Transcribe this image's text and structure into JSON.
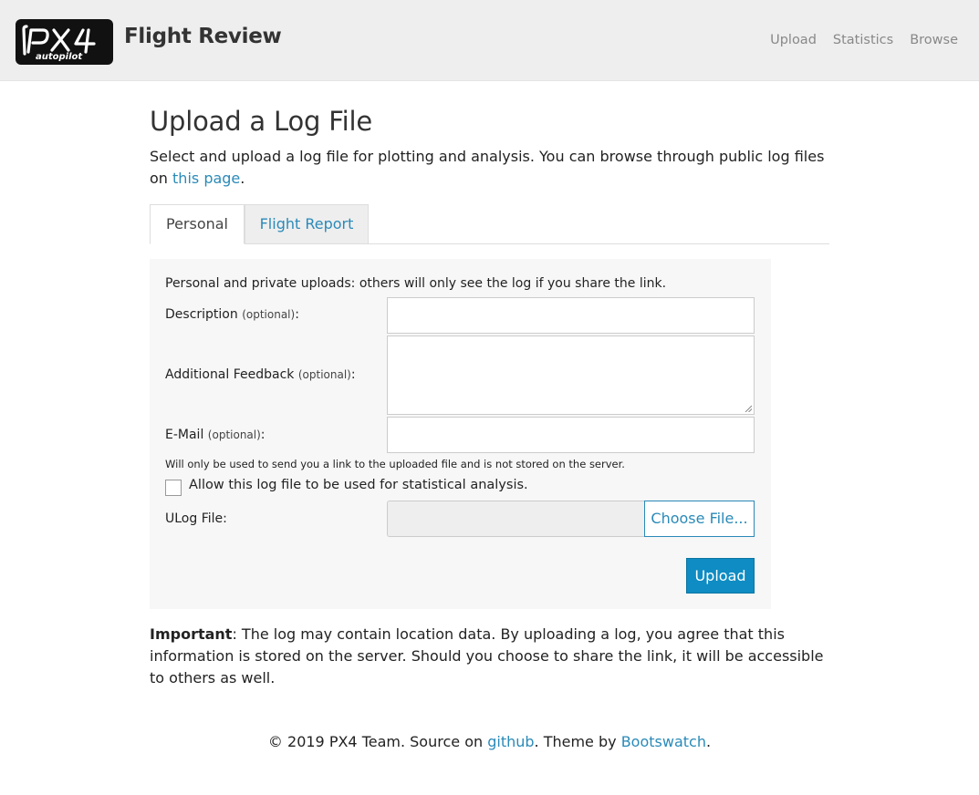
{
  "header": {
    "logo_text": "PX4 autopilot",
    "brand": "Flight Review",
    "nav": [
      "Upload",
      "Statistics",
      "Browse"
    ]
  },
  "main": {
    "title": "Upload a Log File",
    "intro_text": "Select and upload a log file for plotting and analysis. You can browse through public log files on",
    "intro_link": "this page",
    "intro_end": "."
  },
  "tabs": {
    "personal": "Personal",
    "flight_report": "Flight Report"
  },
  "form": {
    "note": "Personal and private uploads: others will only see the log if you share the link.",
    "description_label": "Description",
    "additional_feedback_label": "Additional Feedback",
    "email_label": "E-Mail",
    "optional": "(optional)",
    "colon": ":",
    "description_value": "",
    "feedback_value": "",
    "email_value": "",
    "email_help": "Will only be used to send you a link to the uploaded file and is not stored on the server.",
    "stats_checkbox_label": "Allow this log file to be used for statistical analysis.",
    "stats_checked": false,
    "ulog_label": "ULog File:",
    "choose_file": "Choose File...",
    "upload_button": "Upload"
  },
  "important": {
    "bold": "Important",
    "text": ": The log may contain location data. By uploading a log, you agree that this information is stored on the server. Should you choose to share the link, it will be accessible to others as well."
  },
  "footer": {
    "prefix": "© 2019 PX4 Team. Source on",
    "github": "github",
    "middle": ". Theme by",
    "bootswatch": "Bootswatch",
    "end": "."
  },
  "colors": {
    "link": "#2a8ab8",
    "primary_button": "#0e8cc3",
    "navbar_bg": "#eeeeee",
    "panel_bg": "#f7f7f7"
  }
}
